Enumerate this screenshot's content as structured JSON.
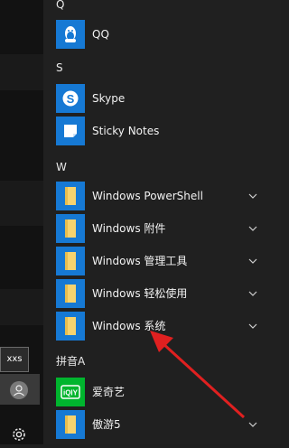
{
  "sections": {
    "q": "Q",
    "s": "S",
    "w": "W",
    "pinyin_a": "拼音A"
  },
  "apps": {
    "qq": "QQ",
    "skype": "Skype",
    "sticky_notes": "Sticky Notes",
    "win_powershell": "Windows PowerShell",
    "win_accessories": "Windows 附件",
    "win_admin_tools": "Windows 管理工具",
    "win_ease_of_access": "Windows 轻松使用",
    "win_system": "Windows 系统",
    "iqiyi": "爱奇艺",
    "aoyou": "傲游5"
  },
  "sidebar": {
    "user_tooltip": "xxs"
  },
  "colors": {
    "tile_blue": "#1679d4",
    "tile_green": "#00b52e",
    "folder_yellow": "#f7d36e",
    "arrow_red": "#e02020"
  },
  "icons": {
    "qq": "qq-penguin-icon",
    "skype": "skype-icon",
    "sticky": "sticky-notes-icon",
    "folder": "folder-icon",
    "iqiyi": "iqiyi-icon",
    "chevron": "chevron-down-icon",
    "avatar": "user-avatar-icon",
    "settings": "gear-icon"
  }
}
